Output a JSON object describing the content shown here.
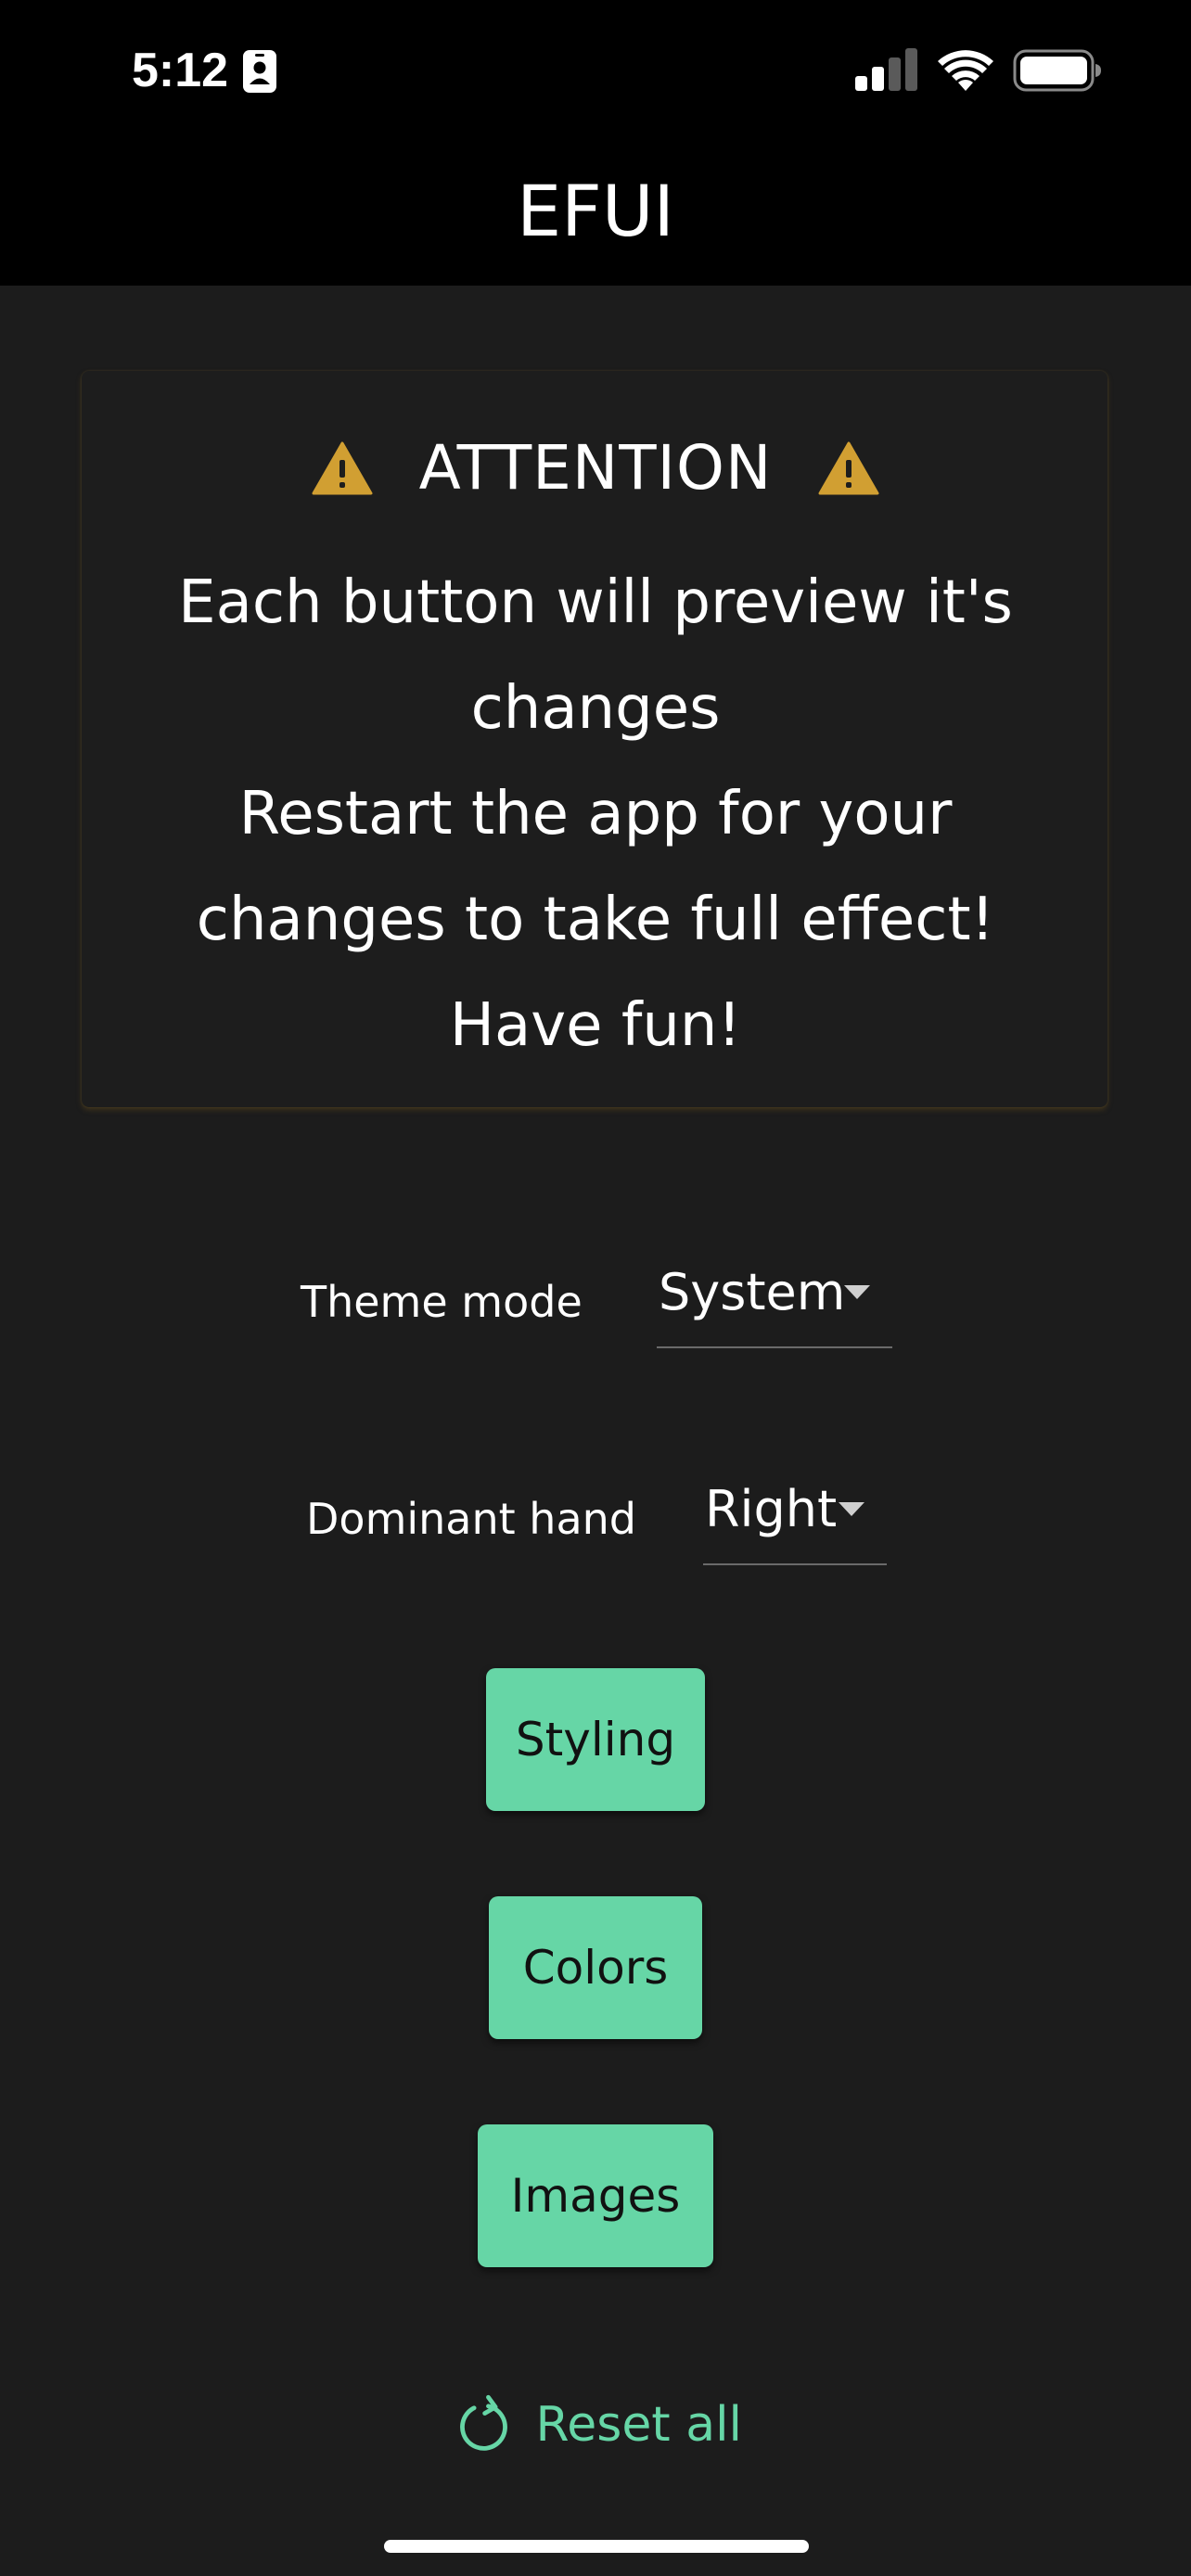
{
  "status_bar": {
    "time": "5:12",
    "icons": [
      "contact-card-icon",
      "cellular-signal-icon",
      "wifi-icon",
      "battery-icon"
    ]
  },
  "app_bar": {
    "title": "EFUI"
  },
  "attention": {
    "title": "ATTENTION",
    "icon": "warning-icon",
    "lines": [
      "Each button will preview it's",
      "changes",
      "Restart the app for your",
      "changes to take full effect!",
      "Have fun!"
    ]
  },
  "settings": {
    "theme_mode": {
      "label": "Theme mode",
      "value": "System"
    },
    "dominant_hand": {
      "label": "Dominant hand",
      "value": "Right"
    }
  },
  "buttons": {
    "styling": "Styling",
    "colors": "Colors",
    "images": "Images"
  },
  "reset": {
    "label": "Reset all",
    "icon": "refresh-icon"
  },
  "colors": {
    "accent": "#66d6a6",
    "warning": "#d19f32",
    "background": "#1c1c1c",
    "app_bar": "#000000"
  }
}
